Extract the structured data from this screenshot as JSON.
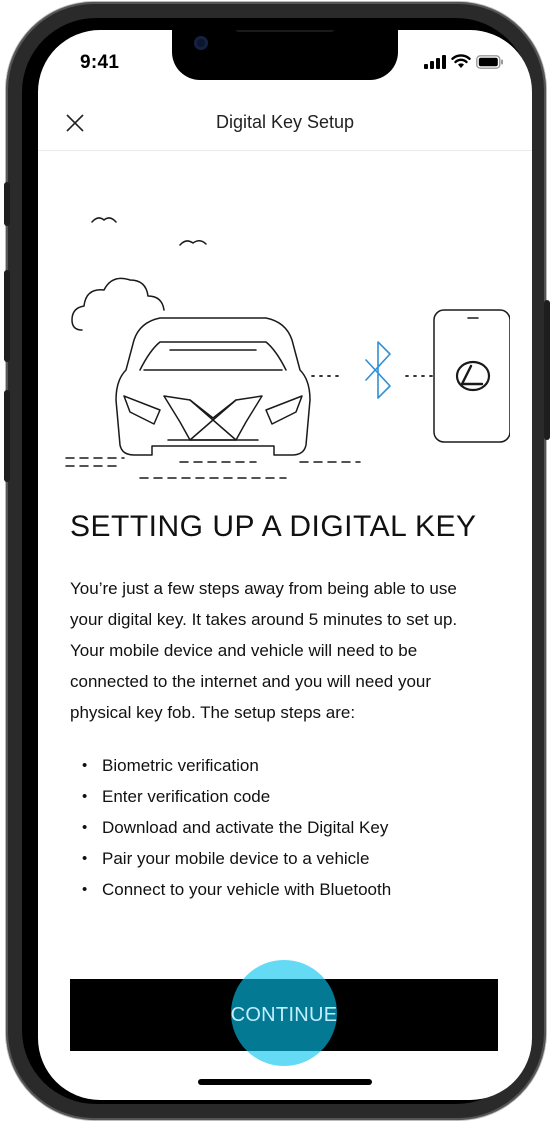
{
  "status_bar": {
    "time": "9:41"
  },
  "header": {
    "title": "Digital Key Setup"
  },
  "content": {
    "heading": "SETTING UP A DIGITAL KEY",
    "intro": "You’re just a few steps away from being able to use your digital key. It takes around 5 minutes to set up. Your mobile device and vehicle will need to be connected to the internet and you will need your physical key fob. The setup steps are:",
    "steps": [
      "Biometric verification",
      "Enter verification code",
      "Download and activate the Digital Key",
      "Pair your mobile device to a vehicle",
      "Connect to your vehicle with Bluetooth"
    ]
  },
  "footer": {
    "continue_label": "CONTINUE"
  },
  "icons": {
    "close": "close-icon",
    "bluetooth": "bluetooth-icon",
    "brand": "lexus-logo-icon"
  },
  "colors": {
    "bluetooth_accent": "#2f8fd8",
    "touch_highlight": "#07c3ef",
    "button_bg": "#000000"
  }
}
